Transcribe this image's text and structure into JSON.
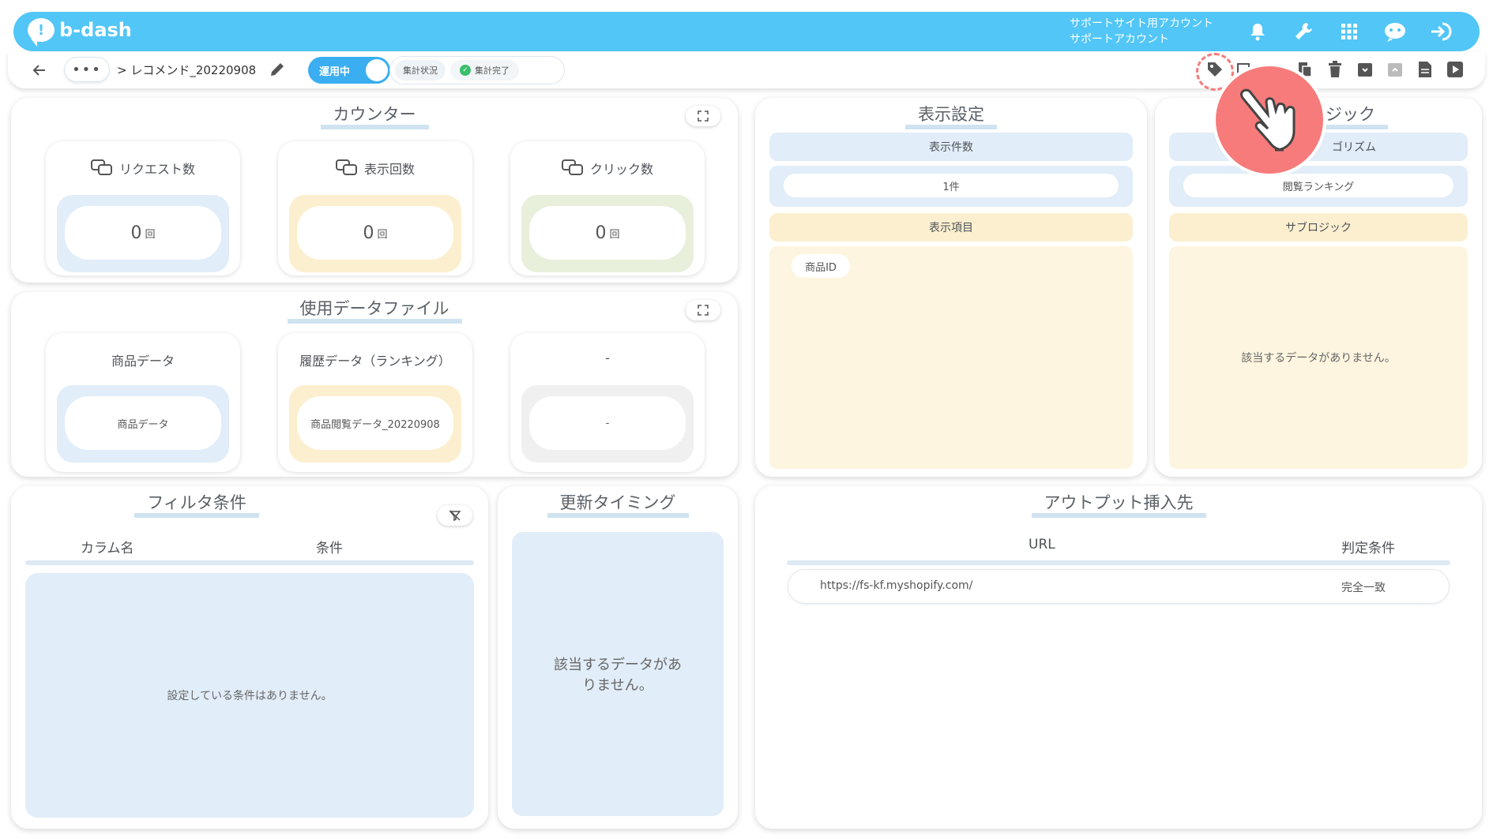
{
  "app": {
    "logo": "b-dash",
    "account_line1": "サポートサイト用アカウント",
    "account_line2": "サポートアカウント"
  },
  "header_icons": [
    "bell-icon",
    "wrench-icon",
    "grid-icon",
    "chat-robot-icon",
    "logout-icon"
  ],
  "subbar": {
    "more": "•••",
    "breadcrumb": "> レコメンド_20220908",
    "toggle_label": "運用中",
    "status_button": "集計状況",
    "status_done": "集計完了"
  },
  "counter": {
    "title": "カウンター",
    "tiles": [
      {
        "label": "リクエスト数",
        "value": "0",
        "unit": "回"
      },
      {
        "label": "表示回数",
        "value": "0",
        "unit": "回"
      },
      {
        "label": "クリック数",
        "value": "0",
        "unit": "回"
      }
    ]
  },
  "datafiles": {
    "title": "使用データファイル",
    "tiles": [
      {
        "label": "商品データ",
        "value": "商品データ"
      },
      {
        "label": "履歴データ（ランキング）",
        "value": "商品閲覧データ_20220908"
      },
      {
        "label": "-",
        "value": "-"
      }
    ]
  },
  "display": {
    "title": "表示設定",
    "count_head": "表示件数",
    "count_value": "1件",
    "items_head": "表示項目",
    "items": [
      "商品ID"
    ]
  },
  "logic": {
    "title_visible": "ジック",
    "algo_head_visible": "ゴリズム",
    "algo_value": "閲覧ランキング",
    "sub_head": "サブロジック",
    "sub_empty": "該当するデータがありません。"
  },
  "filter": {
    "title": "フィルタ条件",
    "col1": "カラム名",
    "col2": "条件",
    "empty": "設定している条件はありません。"
  },
  "timing": {
    "title": "更新タイミング",
    "empty": "該当するデータがありません。"
  },
  "output": {
    "title": "アウトプット挿入先",
    "col1": "URL",
    "col2": "判定条件",
    "rows": [
      {
        "url": "https://fs-kf.myshopify.com/",
        "cond": "完全一致"
      }
    ]
  },
  "colors": {
    "brand": "#52c6f7",
    "toggle": "#3aaef0",
    "highlight": "#f77b7b"
  }
}
